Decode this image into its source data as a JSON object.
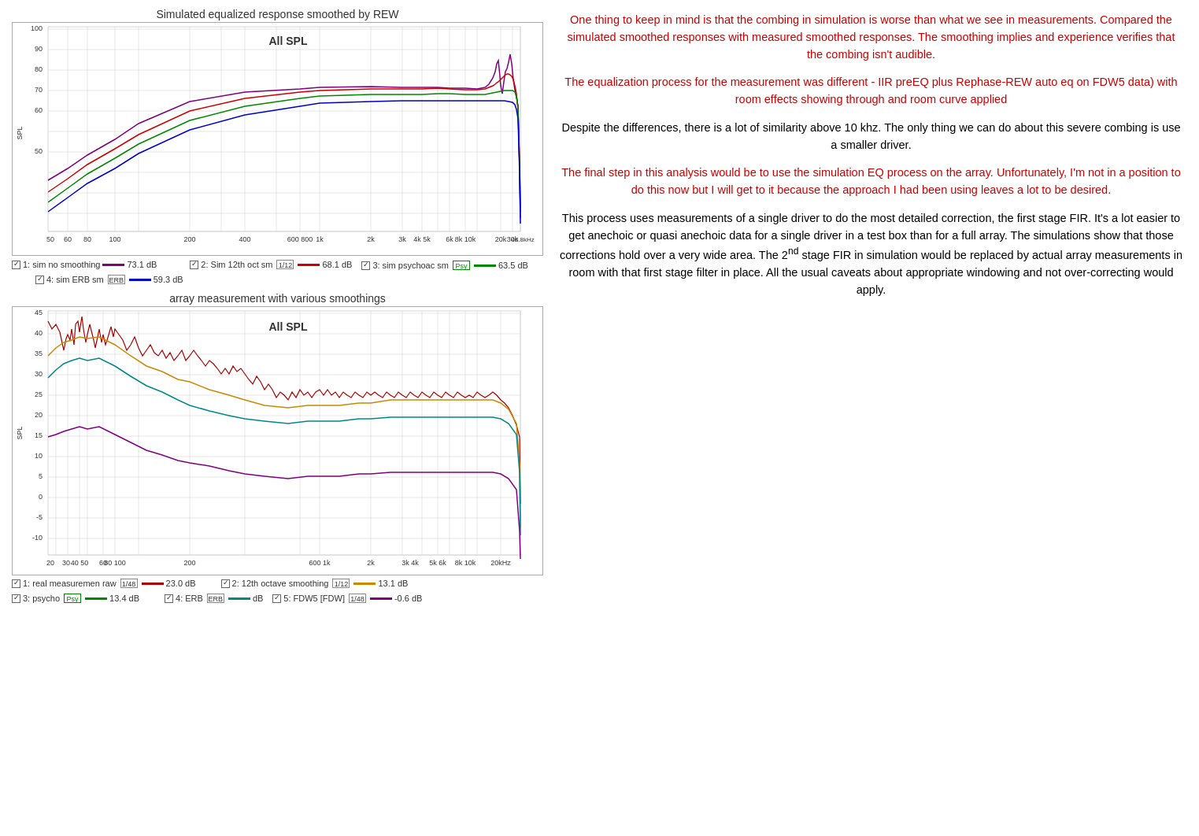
{
  "charts": {
    "top": {
      "title": "Simulated equalized response smoothed by REW",
      "allSPL": "All SPL",
      "legend": [
        {
          "id": 1,
          "label": "1: sim no smoothing",
          "color": "#800080",
          "lineColor": "#800080",
          "value": "73.1 dB",
          "checked": true
        },
        {
          "id": 2,
          "label": "2: Sim 12th oct sm",
          "boxLabel": "1/12",
          "color": "#aa0000",
          "value": "68.1 dB",
          "checked": true
        },
        {
          "id": 3,
          "label": "3: sim psychoac sm",
          "boxLabel": "Psy",
          "boxColor": "#008800",
          "color": "#008800",
          "value": "63.5 dB",
          "checked": true
        },
        {
          "id": 4,
          "label": "4: sim ERB sm",
          "boxLabel": "ERB",
          "color": "#0000cc",
          "value": "59.3 dB",
          "checked": true
        }
      ]
    },
    "bottom": {
      "title": "array measurement with various smoothings",
      "allSPL": "All SPL",
      "legend": [
        {
          "id": 1,
          "label": "1: real measuremen raw",
          "boxLabel": "1/48",
          "color": "#aa0000",
          "value": "23.0 dB",
          "checked": true
        },
        {
          "id": 2,
          "label": "2: 12th octave smoothing",
          "boxLabel": "1/12",
          "color": "#cc0000",
          "value": "13.1 dB",
          "checked": true
        },
        {
          "id": 3,
          "label": "3: psycho",
          "boxLabel": "Psy",
          "boxColor": "#008800",
          "color": "#008800",
          "value": "13.4 dB",
          "checked": true
        },
        {
          "id": 4,
          "label": "4: ERB",
          "boxLabel": "ERB",
          "color": "#008888",
          "value": "dB",
          "checked": true
        },
        {
          "id": 5,
          "label": "5: FDW5 [FDW]",
          "boxLabel": "1/48",
          "color": "#800080",
          "value": "-0.6 dB",
          "checked": true
        }
      ]
    }
  },
  "text": {
    "paragraph1": "One thing to keep in mind is that the combing in simulation is worse than what we see in measurements.  Compared the simulated smoothed responses with measured smoothed responses.  The smoothing implies and experience verifies that the combing isn't audible.",
    "paragraph2": "The equalization process for the measurement was different - IIR preEQ plus Rephase-REW auto eq on FDW5 data) with room effects showing through and room curve applied",
    "paragraph3": "Despite the differences, there is a lot of similarity above 10 khz.  The only thing we can do about this severe combing is use a smaller driver.",
    "paragraph4": "The final step in this analysis would be to  use the simulation EQ process on the array.  Unfortunately, I'm not in a position to do this now but I will get to it because the approach I had been using leaves a lot to be desired.",
    "paragraph5": "This process uses measurements of a single driver to do the most detailed correction, the first stage FIR.  It's a lot easier to get anechoic or quasi anechoic data for a single driver in a test box than for a full array. The simulations show that those corrections hold over a very wide area.   The 2nd stage FIR in simulation would be replaced by actual array measurements in room with that first stage filter in place. All the usual caveats about appropriate windowing and not over-correcting would apply.",
    "nd_superscript": "nd"
  }
}
